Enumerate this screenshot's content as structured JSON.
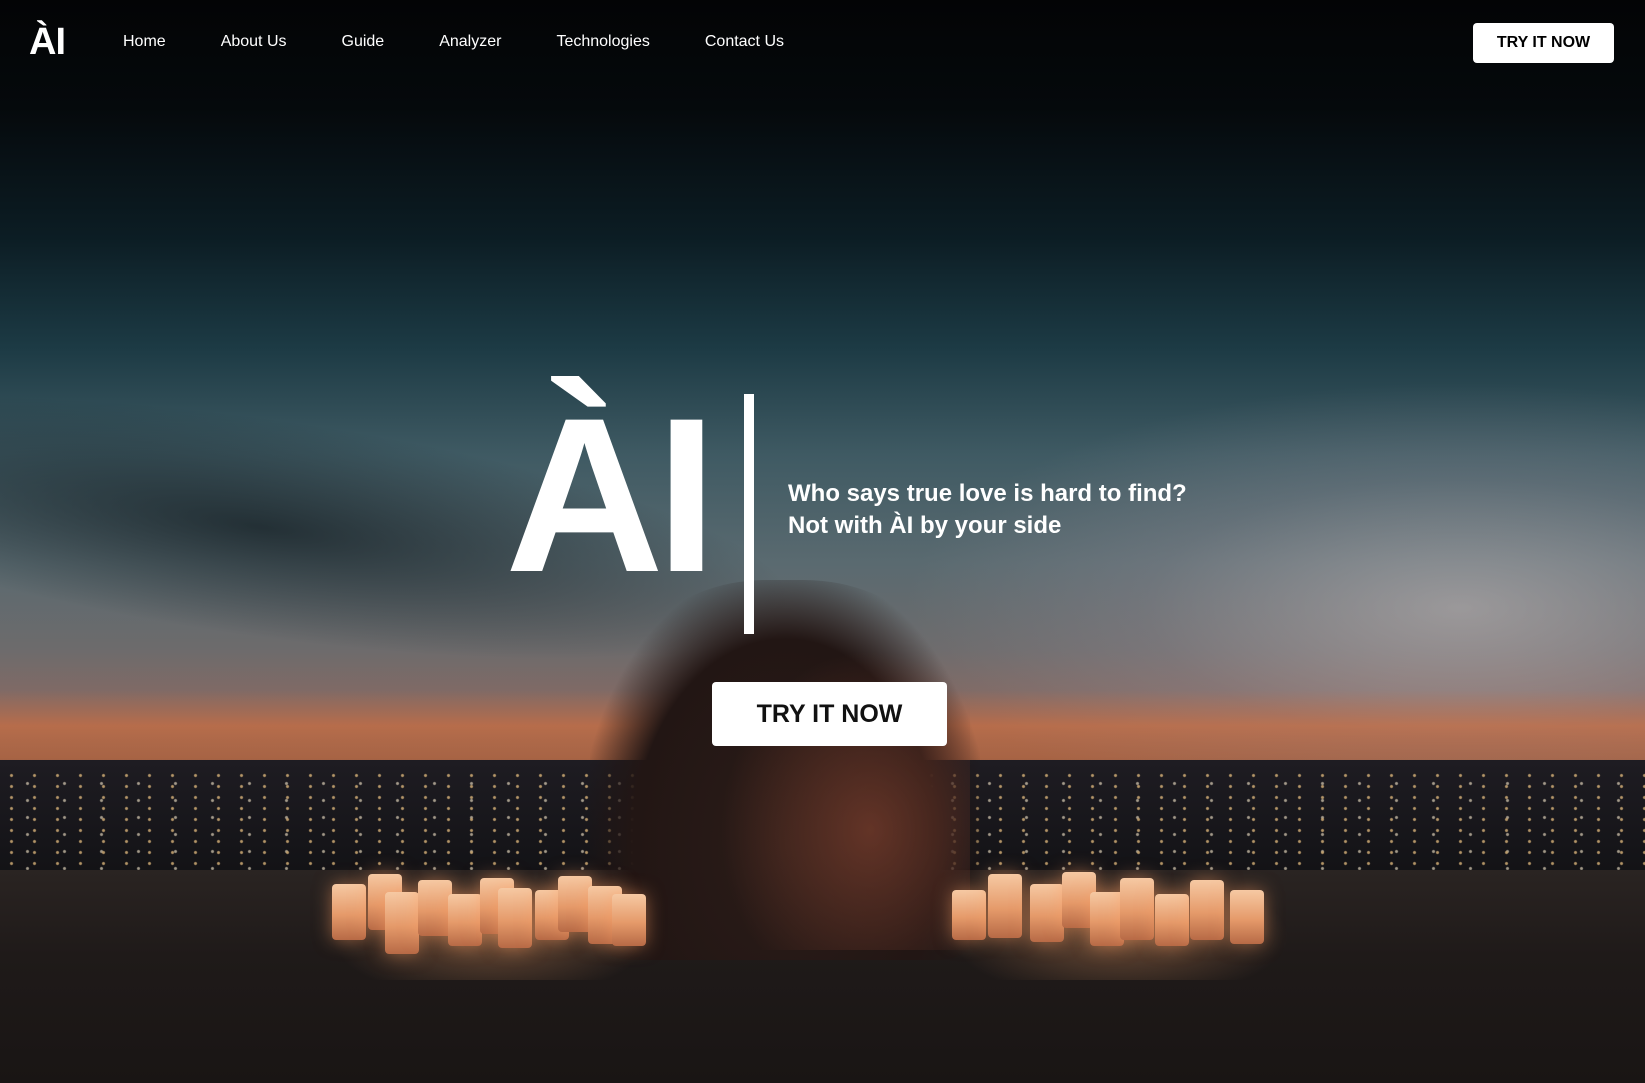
{
  "brand": {
    "logo": "ÀI"
  },
  "nav": {
    "links": [
      "Home",
      "About Us",
      "Guide",
      "Analyzer",
      "Technologies",
      "Contact Us"
    ],
    "cta_label": "TRY IT NOW"
  },
  "hero": {
    "logo": "ÀI",
    "tagline_line1": "Who says true love is hard to find?",
    "tagline_line2": "Not with ÀI by your side",
    "cta_label": "TRY IT NOW"
  },
  "colors": {
    "text": "#ffffff",
    "button_bg": "#ffffff",
    "button_text": "#111111"
  }
}
